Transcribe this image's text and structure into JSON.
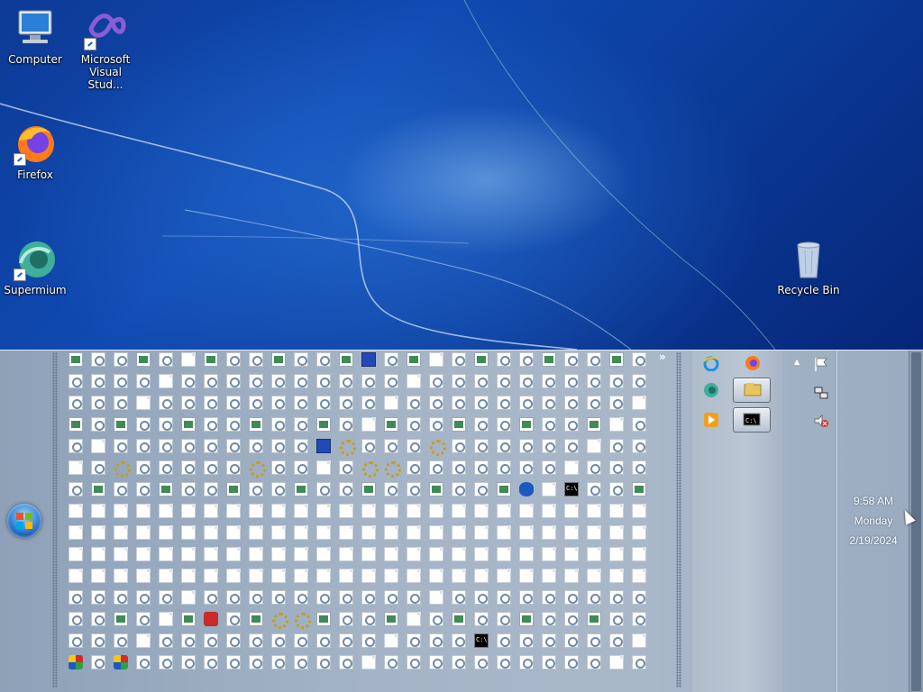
{
  "desktop": {
    "icons": [
      {
        "label": "Computer"
      },
      {
        "label": "Microsoft\nVisual Stud..."
      },
      {
        "label": "Firefox"
      },
      {
        "label": "Supermium"
      },
      {
        "label": "Recycle Bin"
      }
    ]
  },
  "taskbar": {
    "overflow_chevron": "»",
    "quick_launch_rows": 15,
    "quick_launch_cols": 26,
    "running": [
      {
        "icon": "internet-explorer-icon"
      },
      {
        "icon": "firefox-icon"
      },
      {
        "icon": "supermium-icon"
      },
      {
        "icon": "file-explorer-icon"
      },
      {
        "icon": "media-player-icon"
      },
      {
        "icon": "command-prompt-icon"
      }
    ],
    "tray": {
      "show_hidden": "▲",
      "icons": [
        "action-center-flag-icon",
        "network-icon",
        "volume-muted-icon"
      ]
    },
    "clock": {
      "time": "9:58 AM",
      "day": "Monday",
      "date": "2/19/2024"
    }
  },
  "colors": {
    "desktop_blue": "#0f4ab2",
    "taskbar": "#a4b4c6"
  }
}
